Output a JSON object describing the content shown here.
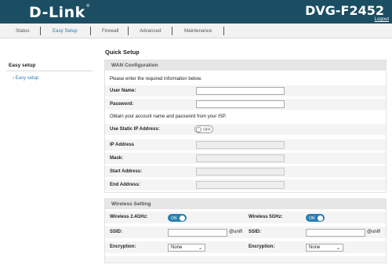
{
  "header": {
    "logo": "D-Link",
    "logo_mark": "®",
    "model": "DVG-F2452",
    "logout": "Logout"
  },
  "nav": {
    "items": [
      "Status",
      "Easy Setup",
      "Firewall",
      "Advanced",
      "Maintenance"
    ],
    "active": "Easy Setup"
  },
  "sidebar": {
    "title": "Easy setup",
    "items": [
      {
        "label": "Easy setup"
      }
    ]
  },
  "page": {
    "title": "Quick Setup"
  },
  "wan": {
    "title": "WAN Configuration",
    "intro": "Please enter the required information below.",
    "user_label": "User Name:",
    "user_value": "",
    "password_label": "Password:",
    "password_value": "",
    "isp_note": "Obtain your account name and password from your ISP.",
    "static_ip_label": "Use Static IP Address:",
    "static_ip_toggle": "OFF",
    "ip_label": "IP Address",
    "mask_label": "Mask:",
    "start_label": "Start Address:",
    "end_label": "End Address:"
  },
  "wireless": {
    "title": "Wireless Setting",
    "w24_label": "Wireless 2.4GHz:",
    "w24_toggle": "ON",
    "w5_label": "Wireless 5GHz:",
    "w5_toggle": "ON",
    "ssid_label": "SSID:",
    "ssid24_value": "",
    "ssid24_suffix": "@unifi",
    "ssid5_label": "SSID:",
    "ssid5_value": "",
    "ssid5_suffix": "@unifi",
    "enc_label": "Encryption:",
    "enc24_value": "None",
    "enc5_label": "Encryption:",
    "enc5_value": "None"
  },
  "colors": {
    "header_bg": "#1c4e63",
    "accent": "#2a7fb0"
  },
  "icons": {
    "select_arrow": "chevron-down-icon",
    "sidebar_bullet": "chevron-right-icon"
  }
}
